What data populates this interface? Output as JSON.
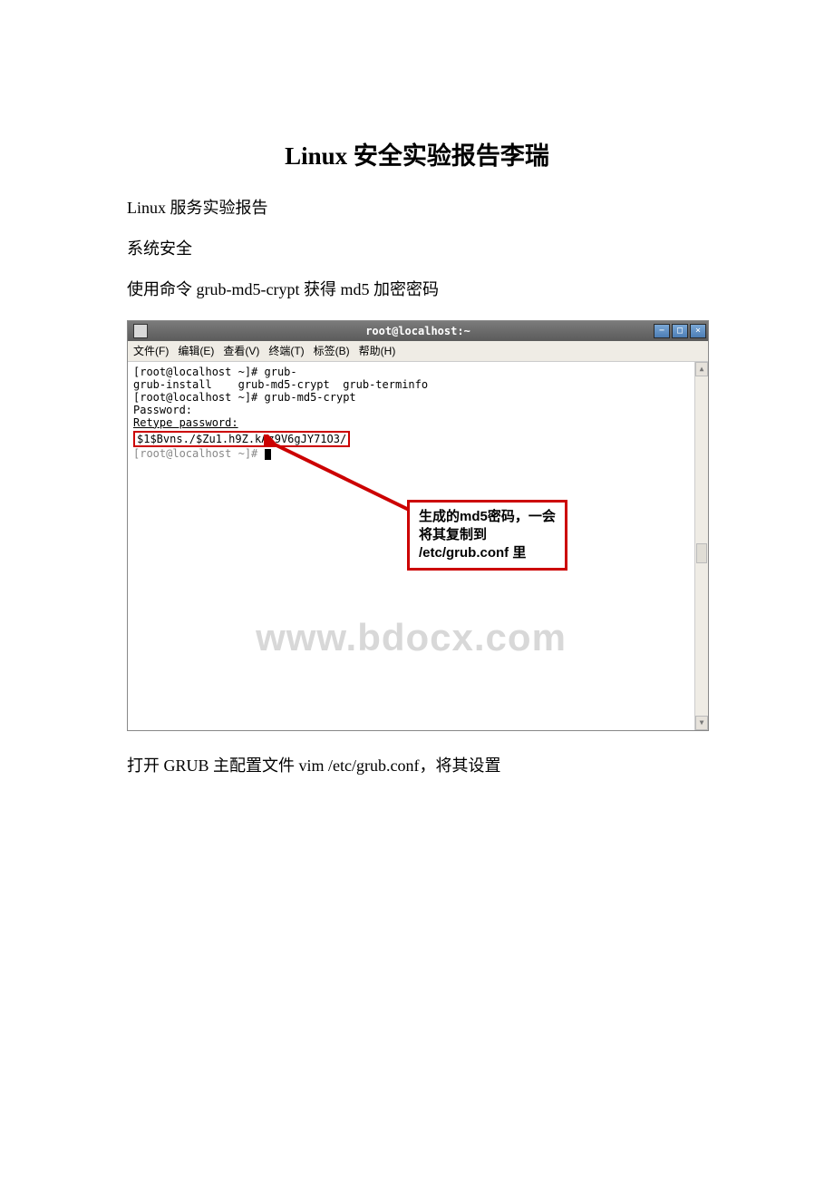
{
  "doc": {
    "title": "Linux 安全实验报告李瑞",
    "p1": "Linux 服务实验报告",
    "p2": "系统安全",
    "p3": "使用命令 grub-md5-crypt 获得 md5 加密密码",
    "p4": "打开 GRUB 主配置文件 vim /etc/grub.conf，将其设置"
  },
  "terminal": {
    "title": "root@localhost:~",
    "menu": {
      "file": "文件(F)",
      "edit": "编辑(E)",
      "view": "查看(V)",
      "terminal": "终端(T)",
      "tabs": "标签(B)",
      "help": "帮助(H)"
    },
    "lines": {
      "l1": "[root@localhost ~]# grub-",
      "l2": "grub-install    grub-md5-crypt  grub-terminfo",
      "l3": "[root@localhost ~]# grub-md5-crypt",
      "l4": "Password:",
      "l5": "Retype password:",
      "md5": "$1$Bvns./$Zu1.h9Z.kAz9V6gJY71O3/",
      "l7": "[root@localhost ~]# "
    },
    "callout": {
      "line1": "生成的md5密码，一会",
      "line2": "将其复制到",
      "line3": "/etc/grub.conf 里"
    },
    "watermark": "www.bdocx.com"
  }
}
